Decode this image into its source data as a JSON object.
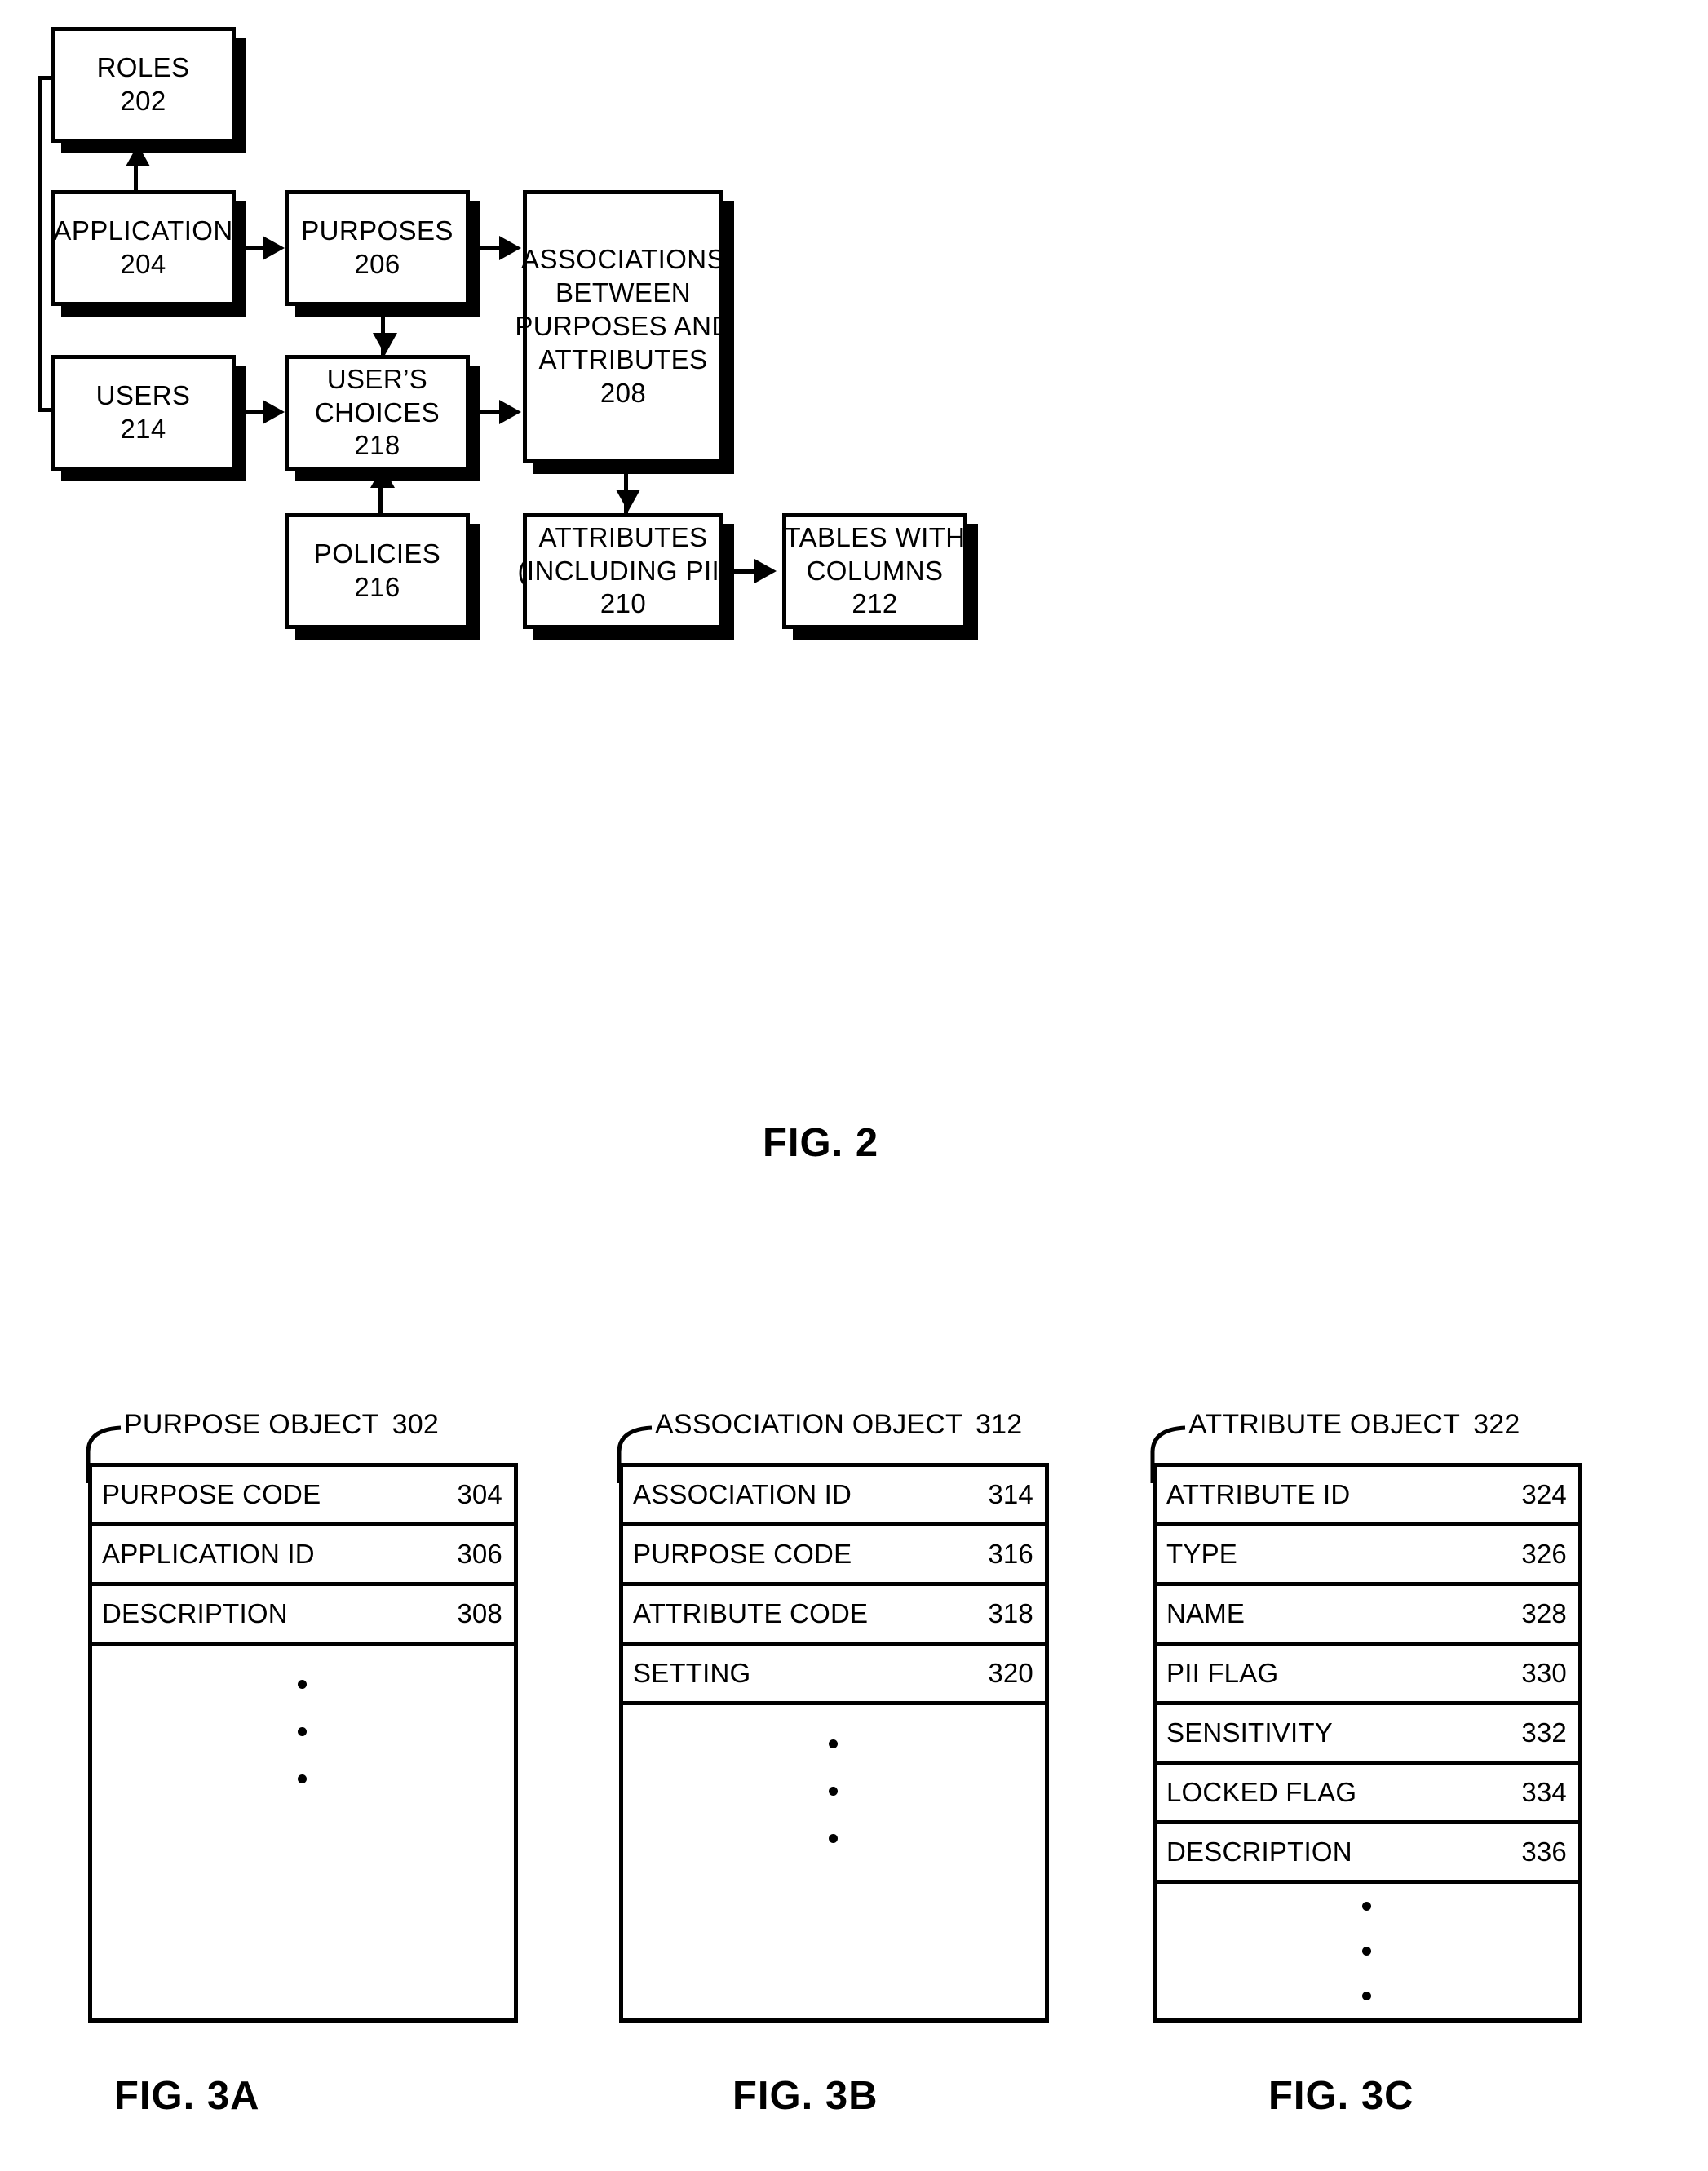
{
  "figure2": {
    "caption": "FIG. 2",
    "boxes": [
      {
        "id": "roles",
        "lines": [
          "ROLES",
          "202"
        ]
      },
      {
        "id": "application",
        "lines": [
          "APPLICATION",
          "204"
        ]
      },
      {
        "id": "purposes",
        "lines": [
          "PURPOSES",
          "206"
        ]
      },
      {
        "id": "associations",
        "lines": [
          "ASSOCIATIONS",
          "BETWEEN",
          "PURPOSES AND",
          "ATTRIBUTES",
          "208"
        ]
      },
      {
        "id": "users",
        "lines": [
          "USERS",
          "214"
        ]
      },
      {
        "id": "user_choices",
        "lines": [
          "USER’S",
          "CHOICES",
          "218"
        ]
      },
      {
        "id": "policies",
        "lines": [
          "POLICIES",
          "216"
        ]
      },
      {
        "id": "attributes",
        "lines": [
          "ATTRIBUTES",
          "(INCLUDING PII)",
          "210"
        ]
      },
      {
        "id": "tables",
        "lines": [
          "TABLES WITH",
          "COLUMNS",
          "212"
        ]
      }
    ]
  },
  "figure3a": {
    "caption": "FIG. 3A",
    "title": "PURPOSE OBJECT",
    "title_number": "302",
    "rows": [
      {
        "label": "PURPOSE CODE",
        "number": "304"
      },
      {
        "label": "APPLICATION ID",
        "number": "306"
      },
      {
        "label": "DESCRIPTION",
        "number": "308"
      }
    ]
  },
  "figure3b": {
    "caption": "FIG. 3B",
    "title": "ASSOCIATION OBJECT",
    "title_number": "312",
    "rows": [
      {
        "label": "ASSOCIATION ID",
        "number": "314"
      },
      {
        "label": "PURPOSE CODE",
        "number": "316"
      },
      {
        "label": "ATTRIBUTE CODE",
        "number": "318"
      },
      {
        "label": "SETTING",
        "number": "320"
      }
    ]
  },
  "figure3c": {
    "caption": "FIG. 3C",
    "title": "ATTRIBUTE OBJECT",
    "title_number": "322",
    "rows": [
      {
        "label": "ATTRIBUTE ID",
        "number": "324"
      },
      {
        "label": "TYPE",
        "number": "326"
      },
      {
        "label": "NAME",
        "number": "328"
      },
      {
        "label": "PII FLAG",
        "number": "330"
      },
      {
        "label": "SENSITIVITY",
        "number": "332"
      },
      {
        "label": "LOCKED FLAG",
        "number": "334"
      },
      {
        "label": "DESCRIPTION",
        "number": "336"
      }
    ]
  }
}
